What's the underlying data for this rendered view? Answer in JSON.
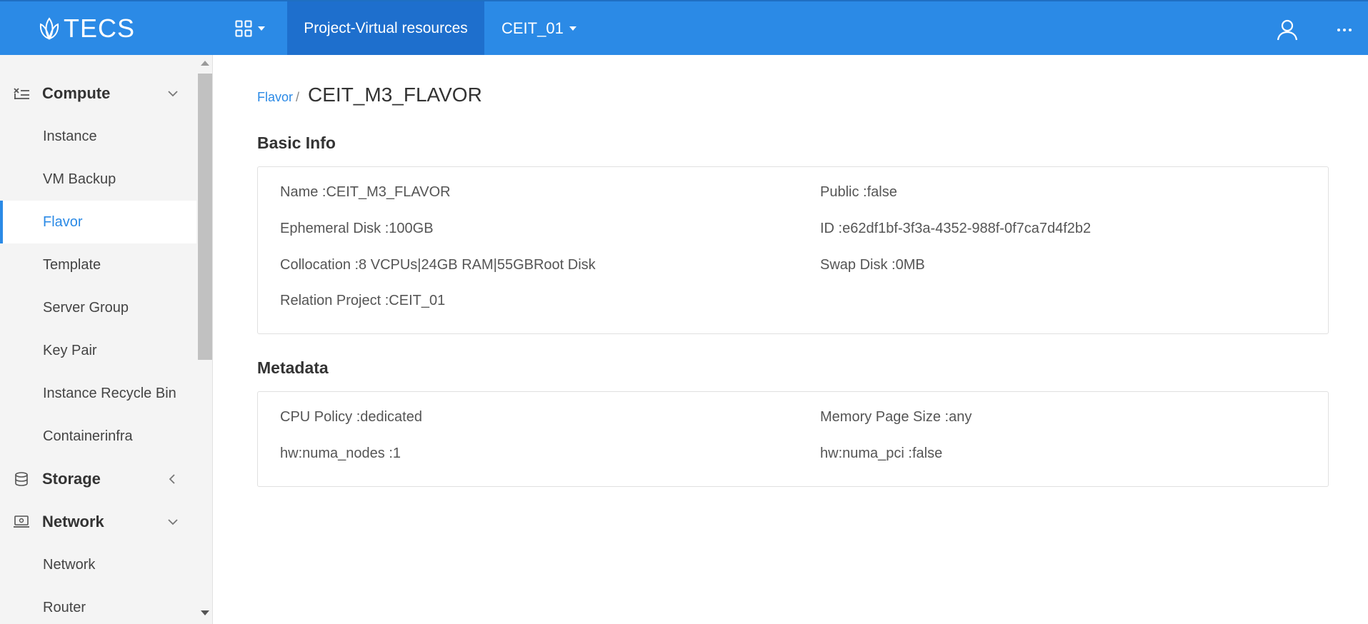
{
  "app": {
    "logo_text": "TECS",
    "nav_active": "Project-Virtual resources",
    "project": "CEIT_01",
    "colors": {
      "brand": "#2b8ae6",
      "brand_dark": "#1e6fcd",
      "active_link": "#2b8ae6"
    },
    "icons": [
      "lotus-logo-icon",
      "apps-grid-icon",
      "user-icon",
      "more-icon"
    ]
  },
  "sidebar": {
    "groups": [
      {
        "label": "Compute",
        "icon": "compute-icon",
        "expanded": true,
        "items": [
          {
            "label": "Instance"
          },
          {
            "label": "VM Backup"
          },
          {
            "label": "Flavor",
            "active": true
          },
          {
            "label": "Template"
          },
          {
            "label": "Server Group"
          },
          {
            "label": "Key Pair"
          },
          {
            "label": "Instance Recycle Bin"
          },
          {
            "label": "Containerinfra"
          }
        ]
      },
      {
        "label": "Storage",
        "icon": "database-icon",
        "expanded": false,
        "items": []
      },
      {
        "label": "Network",
        "icon": "network-icon",
        "expanded": true,
        "items": [
          {
            "label": "Network"
          },
          {
            "label": "Router"
          }
        ]
      }
    ]
  },
  "breadcrumb": {
    "parent": "Flavor",
    "separator": "/",
    "current": "CEIT_M3_FLAVOR"
  },
  "basic_info": {
    "title": "Basic Info",
    "left": [
      "Name :CEIT_M3_FLAVOR",
      "Ephemeral Disk :100GB",
      "Collocation :8 VCPUs|24GB RAM|55GBRoot Disk",
      "Relation Project :CEIT_01"
    ],
    "right": [
      "Public :false",
      "ID :e62df1bf-3f3a-4352-988f-0f7ca7d4f2b2",
      "Swap Disk :0MB"
    ]
  },
  "metadata": {
    "title": "Metadata",
    "left": [
      "CPU Policy :dedicated",
      "hw:numa_nodes :1"
    ],
    "right": [
      "Memory Page Size :any",
      "hw:numa_pci :false"
    ]
  }
}
